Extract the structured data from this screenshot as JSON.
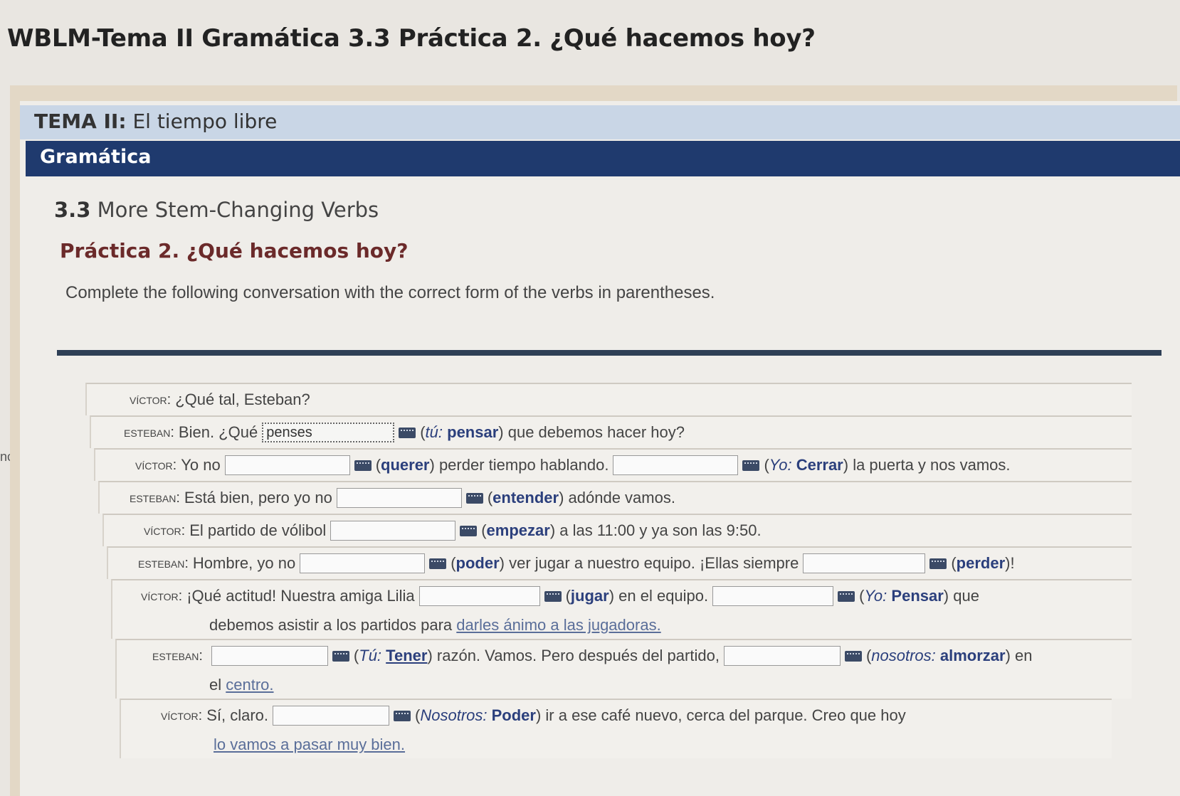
{
  "page": {
    "title": "WBLM-Tema II Gramática 3.3 Práctica 2. ¿Qué hacemos hoy?",
    "side_text": "nces"
  },
  "header": {
    "tema_label": "TEMA II:",
    "tema_title": "El tiempo libre",
    "section_bar": "Gramática",
    "section_number": "3.3",
    "section_title": "More Stem-Changing Verbs",
    "practice_title": "Práctica 2. ¿Qué hacemos hoy?",
    "instructions": "Complete the following conversation with the correct form of the verbs in parentheses."
  },
  "speakers": {
    "victor": "Víctor:",
    "esteban": "Esteban:"
  },
  "lines": {
    "l1": {
      "text": "¿Qué tal, Esteban?"
    },
    "l2": {
      "pre": "Bien. ¿Qué",
      "blank1": "penses",
      "hint_open": "(",
      "hint_subj": "tú:",
      "hint_verb": "pensar",
      "post": ") que debemos hacer hoy?"
    },
    "l3": {
      "pre": "Yo no",
      "b1_open": "(",
      "b1_verb": "querer",
      "b1_post": ") perder tiempo hablando.",
      "b2_open": "(",
      "b2_subj": "Yo:",
      "b2_verb": "Cerrar",
      "b2_post": ") la puerta y nos vamos."
    },
    "l4": {
      "pre": "Está bien, pero yo no",
      "open": "(",
      "verb": "entender",
      "post": ") adónde vamos."
    },
    "l5": {
      "pre": "El partido de vólibol",
      "open": "(",
      "verb": "empezar",
      "post": ") a las 11:00 y ya son las 9:50."
    },
    "l6": {
      "pre": "Hombre, yo no",
      "b1_open": "(",
      "b1_verb": "poder",
      "b1_post": ") ver jugar a nuestro equipo. ¡Ellas siempre",
      "b2_open": "(",
      "b2_verb": "perder",
      "b2_post": ")!"
    },
    "l7": {
      "pre": "¡Qué actitud! Nuestra amiga Lilia",
      "b1_open": "(",
      "b1_verb": "jugar",
      "b1_post": ") en el equipo.",
      "b2_open": "(",
      "b2_subj": "Yo:",
      "b2_verb": "Pensar",
      "b2_post": ") que",
      "cont_pre": "debemos asistir a los partidos para",
      "cont_link": "darles ánimo a las jugadoras."
    },
    "l8": {
      "b1_open": "(",
      "b1_subj": "Tú:",
      "b1_verb": "Tener",
      "b1_post": ") razón. Vamos. Pero después del partido,",
      "b2_open": "(",
      "b2_subj": "nosotros:",
      "b2_verb": "almorzar",
      "b2_post": ") en",
      "cont_pre": "el",
      "cont_link": "centro."
    },
    "l9": {
      "pre": "Sí, claro.",
      "open": "(",
      "subj": "Nosotros:",
      "verb": "Poder",
      "post": ") ir a ese café nuevo, cerca del parque. Creo que hoy",
      "cont_link": "lo vamos a pasar muy bien."
    }
  }
}
